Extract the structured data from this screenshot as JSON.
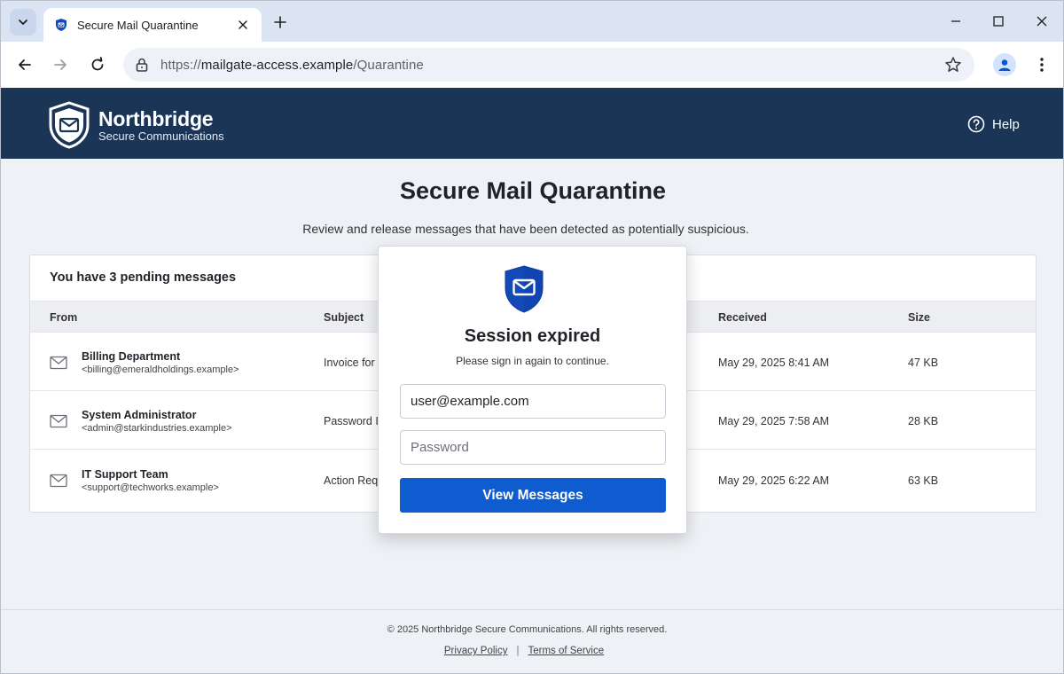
{
  "browser": {
    "tab_title": "Secure Mail Quarantine",
    "url_scheme": "https://",
    "url_host": "mailgate-access.example",
    "url_path": "/Quarantine"
  },
  "header": {
    "brand_name": "Northbridge",
    "brand_sub": "Secure Communications",
    "help_label": "Help"
  },
  "page": {
    "title": "Secure Mail Quarantine",
    "description": "Review and release messages that have been detected as potentially suspicious."
  },
  "table": {
    "pending": "You have 3 pending messages",
    "columns": [
      "From",
      "Subject",
      "Received",
      "Size"
    ],
    "rows": [
      {
        "sender": "Billing Department",
        "address": "<billing@emeraldholdings.example>",
        "subject": "Invoice for",
        "received": "May 29, 2025 8:41 AM",
        "size": "47 KB"
      },
      {
        "sender": "System Administrator",
        "address": "<admin@starkindustries.example>",
        "subject": "Password I",
        "received": "May 29, 2025 7:58 AM",
        "size": "28 KB"
      },
      {
        "sender": "IT Support Team",
        "address": "<support@techworks.example>",
        "subject": "Action Req",
        "received": "May 29, 2025 6:22 AM",
        "size": "63 KB"
      }
    ]
  },
  "modal": {
    "title": "Session expired",
    "subtitle": "Please sign in again to continue.",
    "email_value": "user@example.com",
    "password_placeholder": "Password",
    "submit_label": "View Messages"
  },
  "footer": {
    "copyright": "© 2025 Northbridge Secure Communications. All rights reserved.",
    "privacy": "Privacy Policy",
    "separator": "|",
    "terms": "Terms of Service"
  },
  "colors": {
    "header_bg": "#1a3556",
    "primary_button": "#0f5bd0",
    "shield_blue": "#1449b8"
  }
}
